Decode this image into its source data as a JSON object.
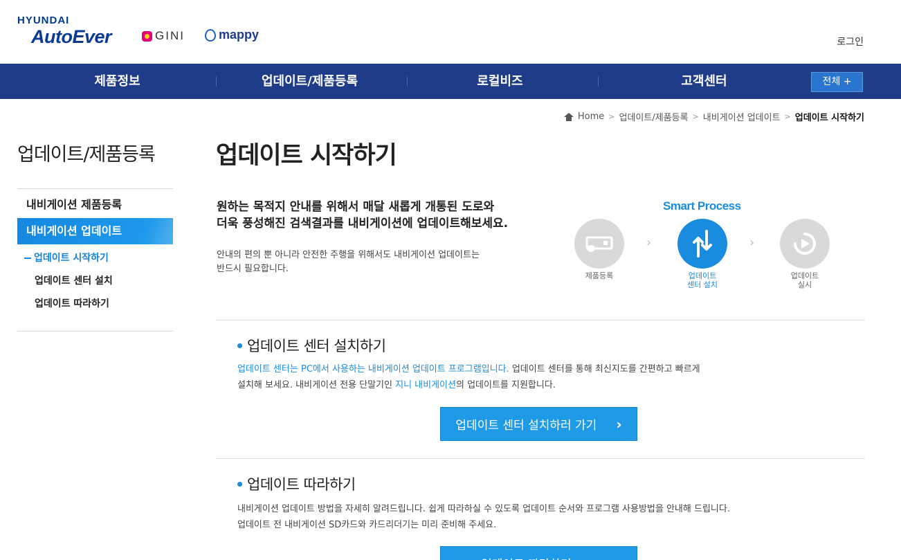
{
  "header": {
    "brand_hyundai": "HYUNDAI",
    "brand_autoever": "AutoEver",
    "brand_gini": "GINI",
    "brand_mappy": "mappy",
    "login": "로그인"
  },
  "nav": {
    "items": [
      {
        "label": "제품정보"
      },
      {
        "label": "업데이트/제품등록"
      },
      {
        "label": "로컬비즈"
      },
      {
        "label": "고객센터"
      }
    ],
    "all_button": "전체 +"
  },
  "breadcrumb": {
    "home": "Home",
    "items": [
      "업데이트/제품등록",
      "내비게이션 업데이트"
    ],
    "current": "업데이트 시작하기"
  },
  "sidebar": {
    "title": "업데이트/제품등록",
    "items": [
      {
        "label": "내비게이션 제품등록",
        "active": false
      },
      {
        "label": "내비게이션 업데이트",
        "active": true
      }
    ],
    "subitems": [
      {
        "label": "업데이트 시작하기",
        "current": true
      },
      {
        "label": "업데이트 센터 설치",
        "current": false
      },
      {
        "label": "업데이트 따라하기",
        "current": false
      }
    ]
  },
  "main": {
    "title": "업데이트 시작하기",
    "headline_line1": "원하는 목적지 안내를 위해서 매달 새롭게 개통된 도로와",
    "headline_line2": "더욱 풍성해진 검색결과를 내비게이션에 업데이트해보세요.",
    "desc_line1": "안내의 편의 뿐 아니라 안전한 주행을 위해서도 내비게이션 업데이트는",
    "desc_line2": "반드시 필요합니다.",
    "smart_process": {
      "title": "Smart Process",
      "steps": [
        {
          "line1": "제품등록",
          "line2": "",
          "active": false,
          "icon": "device-register-icon"
        },
        {
          "line1": "업데이트",
          "line2": "센터 설치",
          "active": true,
          "icon": "update-arrows-icon"
        },
        {
          "line1": "업데이트",
          "line2": "실시",
          "active": false,
          "icon": "play-circle-icon"
        }
      ]
    },
    "section1": {
      "title": "업데이트 센터 설치하기",
      "line1_blue": "업데이트 센터는 PC에서 사용하는 내비게이션 업데이트 프로그램입니다.",
      "line1_rest": " 업데이트 센터를 통해 최신지도를 간편하고 빠르게",
      "line2_a": "설치해 보세요. 내비게이션 전용 단말기인 ",
      "line2_blue": "지니 내비게이션",
      "line2_b": "의 업데이트를 지원합니다.",
      "button": "업데이트 센터 설치하러 가기"
    },
    "section2": {
      "title": "업데이트 따라하기",
      "line1": "내비게이션 업데이트 방법을 자세히 알려드립니다. 쉽게 따라하실 수 있도록 업데이트 순서와 프로그램 사용방법을 안내해 드립니다.",
      "line2": "업데이트 전 내비게이션 SD카드와 카드리더기는 미리 준비해 주세요.",
      "button": "업데이트 따라하기"
    }
  },
  "colors": {
    "nav_bg": "#1f3c88",
    "accent_blue": "#1a8ce0",
    "button_blue": "#1f9ae6",
    "inactive_step": "#d9d9d9"
  }
}
